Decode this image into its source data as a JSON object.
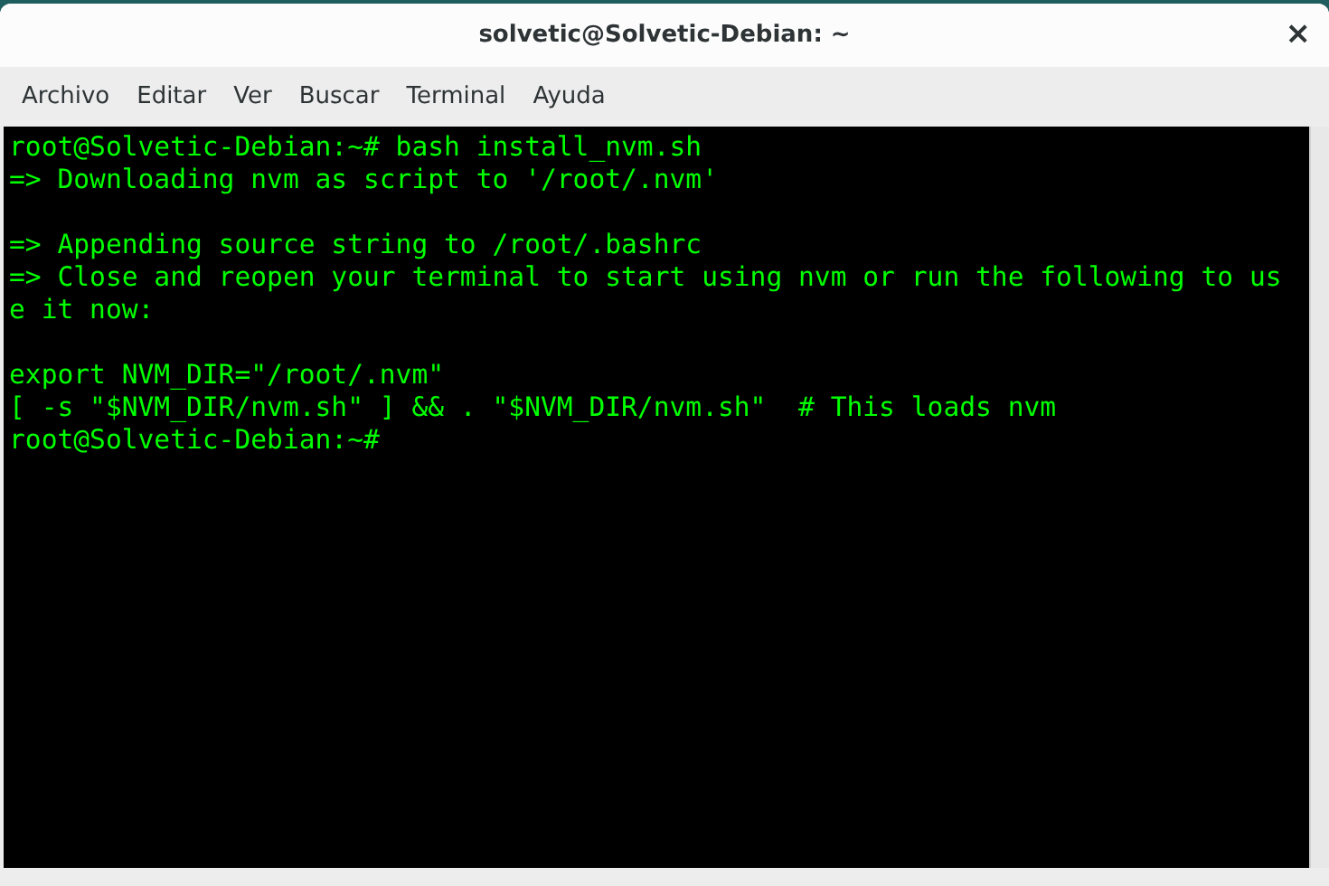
{
  "window": {
    "title": "solvetic@Solvetic-Debian: ~",
    "close": "×"
  },
  "menu": [
    "Archivo",
    "Editar",
    "Ver",
    "Buscar",
    "Terminal",
    "Ayuda"
  ],
  "terminal": {
    "blocks": [
      [
        "root@Solvetic-Debian:~# bash install_nvm.sh",
        "=> Downloading nvm as script to '/root/.nvm'"
      ],
      [
        "=> Appending source string to /root/.bashrc",
        "=> Close and reopen your terminal to start using nvm or run the following to us",
        "e it now:"
      ],
      [
        "export NVM_DIR=\"/root/.nvm\"",
        "[ -s \"$NVM_DIR/nvm.sh\" ] && . \"$NVM_DIR/nvm.sh\"  # This loads nvm",
        "root@Solvetic-Debian:~#"
      ]
    ]
  }
}
